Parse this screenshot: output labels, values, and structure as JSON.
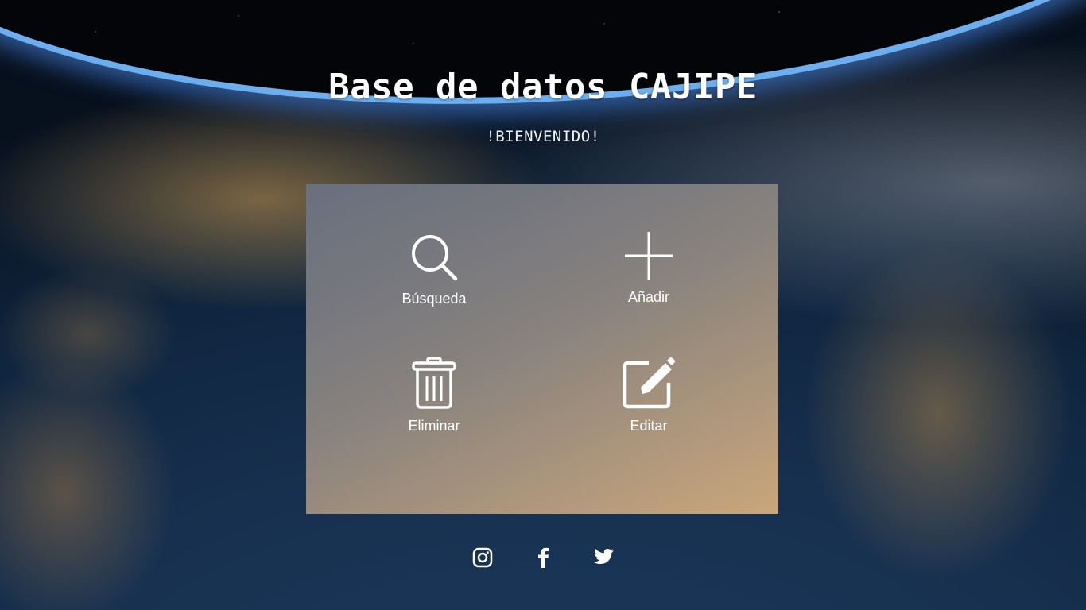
{
  "header": {
    "title": "Base de datos CAJIPE",
    "subtitle": "!BIENVENIDO!"
  },
  "menu": {
    "items": [
      {
        "label": "Búsqueda",
        "icon": "search-icon"
      },
      {
        "label": "Añadir",
        "icon": "plus-icon"
      },
      {
        "label": "Eliminar",
        "icon": "trash-icon"
      },
      {
        "label": "Editar",
        "icon": "edit-icon"
      }
    ]
  },
  "social": {
    "items": [
      {
        "icon": "instagram-icon"
      },
      {
        "icon": "facebook-icon"
      },
      {
        "icon": "twitter-icon"
      }
    ]
  },
  "colors": {
    "text": "#ffffff",
    "panel_start": "#687080",
    "panel_end": "#d0aa7c",
    "background": "#102640"
  }
}
